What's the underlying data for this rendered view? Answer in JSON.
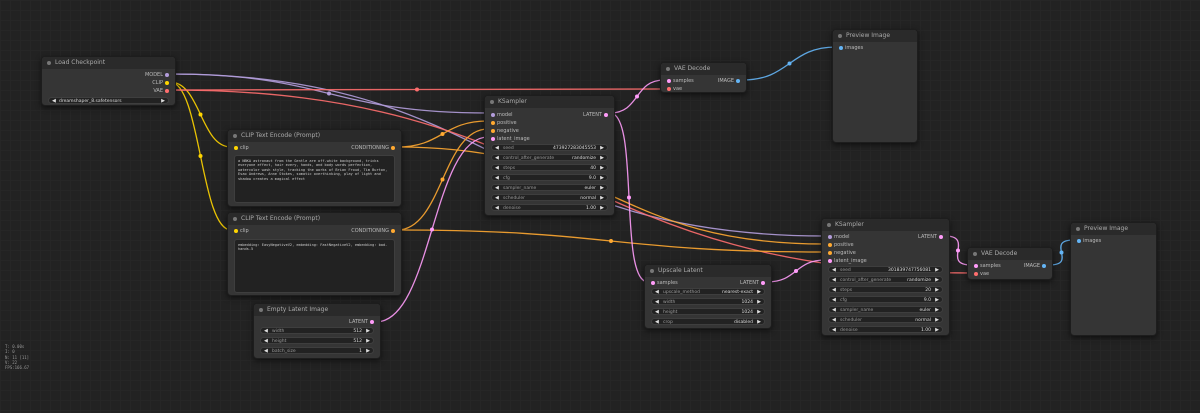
{
  "colors": {
    "model": "#b39ddb",
    "clip": "#ffd500",
    "vae": "#ff6e6e",
    "conditioning": "#ffa931",
    "latent": "#ff9cf9",
    "image": "#64b5f6"
  },
  "nodes": {
    "load_checkpoint": {
      "title": "Load Checkpoint",
      "outputs": [
        "MODEL",
        "CLIP",
        "VAE"
      ],
      "ckpt_name": "dreamshaper_8.safetensors"
    },
    "clip_pos": {
      "title": "CLIP Text Encode (Prompt)",
      "input": "clip",
      "output": "CONDITIONING",
      "text": "a NBKA astronaut from the Gentle are off-white background, tricks everyone effect, hair every, hands, and body words perfection, watercolor wash style, tracking the works of Brian Froud, Tim Burton, Esao Andrews, Anne Stokes, somatic overthinking, play of light and shadow creates a magical effect"
    },
    "clip_neg": {
      "title": "CLIP Text Encode (Prompt)",
      "input": "clip",
      "output": "CONDITIONING",
      "text": "embedding: EasyNegativeV2, embedding: FastNegativeV2, embedding: bad-hands-5"
    },
    "empty_latent": {
      "title": "Empty Latent Image",
      "output": "LATENT",
      "widgets": [
        {
          "label": "width",
          "value": "512"
        },
        {
          "label": "height",
          "value": "512"
        },
        {
          "label": "batch_size",
          "value": "1"
        }
      ]
    },
    "ksampler1": {
      "title": "KSampler",
      "inputs": [
        "model",
        "positive",
        "negative",
        "latent_image"
      ],
      "output": "LATENT",
      "widgets": [
        {
          "label": "seed",
          "value": "473927283045553"
        },
        {
          "label": "control_after_generate",
          "value": "randomize"
        },
        {
          "label": "steps",
          "value": "40"
        },
        {
          "label": "cfg",
          "value": "9.0"
        },
        {
          "label": "sampler_name",
          "value": "euler"
        },
        {
          "label": "scheduler",
          "value": "normal"
        },
        {
          "label": "denoise",
          "value": "1.00"
        }
      ]
    },
    "vae_decode1": {
      "title": "VAE Decode",
      "inputs": [
        "samples",
        "vae"
      ],
      "output": "IMAGE"
    },
    "preview1": {
      "title": "Preview Image",
      "input": "images"
    },
    "upscale": {
      "title": "Upscale Latent",
      "input": "samples",
      "output": "LATENT",
      "widgets": [
        {
          "label": "upscale_method",
          "value": "nearest-exact"
        },
        {
          "label": "width",
          "value": "1024"
        },
        {
          "label": "height",
          "value": "1024"
        },
        {
          "label": "crop",
          "value": "disabled"
        }
      ]
    },
    "ksampler2": {
      "title": "KSampler",
      "inputs": [
        "model",
        "positive",
        "negative",
        "latent_image"
      ],
      "output": "LATENT",
      "widgets": [
        {
          "label": "seed",
          "value": "301839747756081"
        },
        {
          "label": "control_after_generate",
          "value": "randomize"
        },
        {
          "label": "steps",
          "value": "20"
        },
        {
          "label": "cfg",
          "value": "9.0"
        },
        {
          "label": "sampler_name",
          "value": "euler"
        },
        {
          "label": "scheduler",
          "value": "normal"
        },
        {
          "label": "denoise",
          "value": "1.00"
        }
      ]
    },
    "vae_decode2": {
      "title": "VAE Decode",
      "inputs": [
        "samples",
        "vae"
      ],
      "output": "IMAGE"
    },
    "preview2": {
      "title": "Preview Image",
      "input": "images"
    }
  },
  "stats": [
    "T: 0.00s",
    "I: 0",
    "N: 11 [11]",
    "V: 22",
    "FPS:166.67"
  ]
}
